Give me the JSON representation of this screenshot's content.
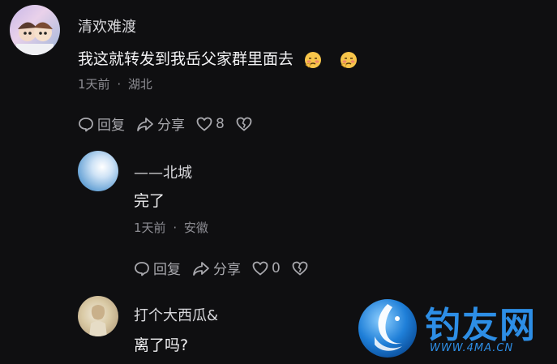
{
  "comments": [
    {
      "user": "清欢难渡",
      "text": "我这就转发到我岳父家群里面去",
      "time": "1天前",
      "separator": "·",
      "location": "湖北",
      "reply_label": "回复",
      "share_label": "分享",
      "likes": "8",
      "emoji_count": 2
    },
    {
      "user": "——北城",
      "text": "完了",
      "time": "1天前",
      "separator": "·",
      "location": "安徽",
      "reply_label": "回复",
      "share_label": "分享",
      "likes": "0"
    },
    {
      "user": "打个大西瓜&",
      "text": "离了吗?"
    }
  ],
  "watermark": {
    "title": "钓友网",
    "url": "WWW.4MA.CN",
    "color": "#2d8ee6"
  },
  "icons": [
    "reply-icon",
    "share-icon",
    "heart-icon",
    "broken-heart-icon",
    "shy-face-emoji"
  ]
}
